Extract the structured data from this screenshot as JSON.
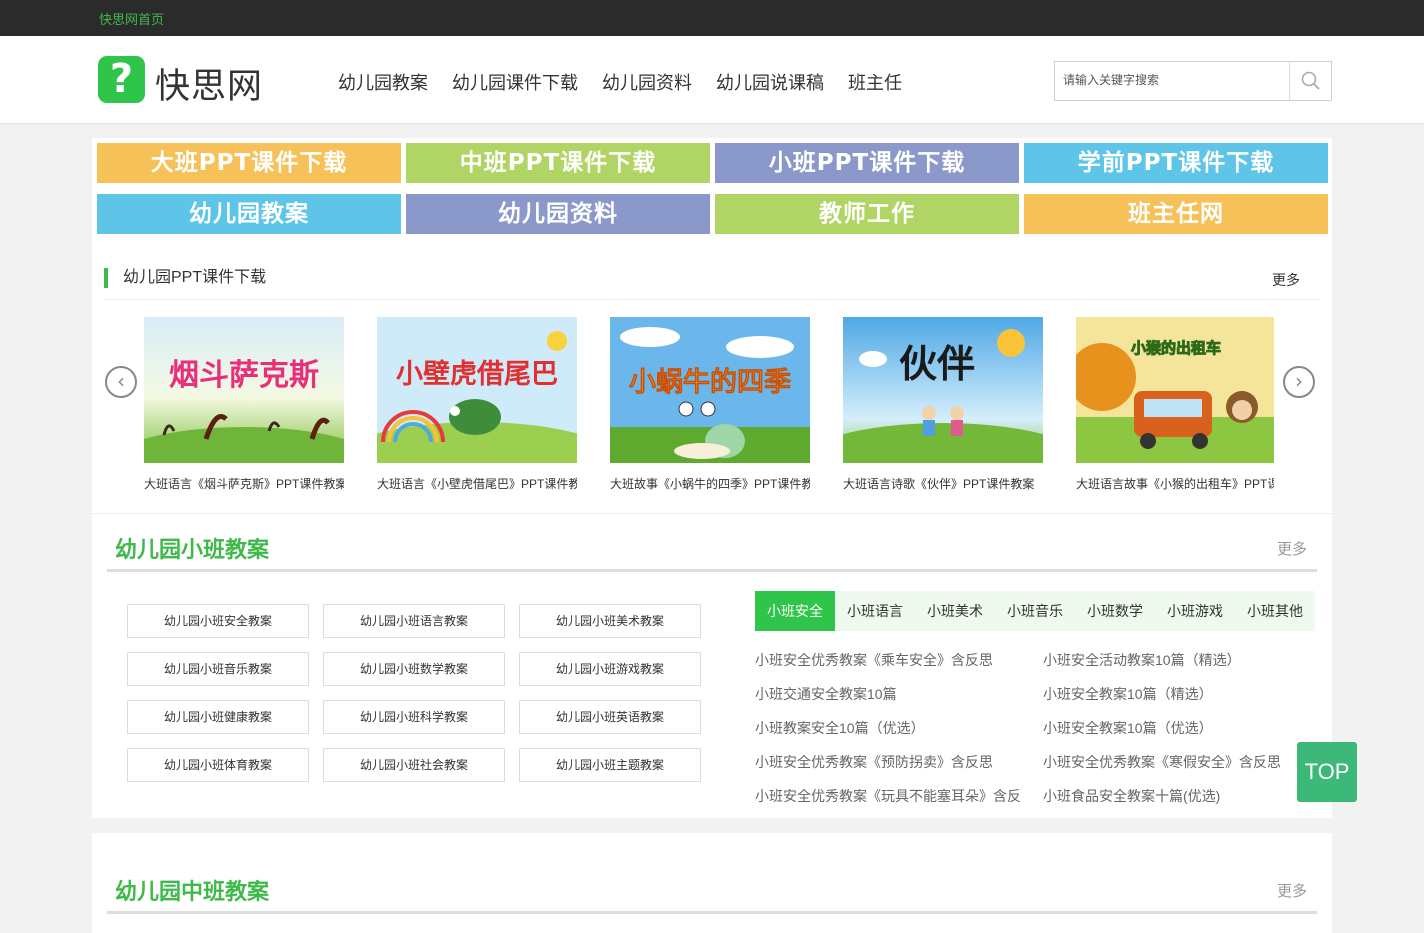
{
  "topbar": {
    "home_link": "快思网首页"
  },
  "header": {
    "logo_text": "快思网",
    "nav": [
      "幼儿园教案",
      "幼儿园课件下载",
      "幼儿园资料",
      "幼儿园说课稿",
      "班主任"
    ],
    "search_placeholder": "请输入关键字搜索"
  },
  "categories": [
    {
      "label": "大班PPT课件下载",
      "color": "#f6c158"
    },
    {
      "label": "中班PPT课件下载",
      "color": "#b0d565"
    },
    {
      "label": "小班PPT课件下载",
      "color": "#8b99ca"
    },
    {
      "label": "学前PPT课件下载",
      "color": "#5ec5e8"
    },
    {
      "label": "幼儿园教案",
      "color": "#5ec5e8"
    },
    {
      "label": "幼儿园资料",
      "color": "#8b99ca"
    },
    {
      "label": "教师工作",
      "color": "#b0d565"
    },
    {
      "label": "班主任网",
      "color": "#f6c158"
    }
  ],
  "ppt_section": {
    "title": "幼儿园PPT课件下载",
    "more": "更多",
    "items": [
      {
        "thumb_text": "烟斗萨克斯",
        "caption": "大班语言《烟斗萨克斯》PPT课件教案"
      },
      {
        "thumb_text": "小壁虎借尾巴",
        "caption": "大班语言《小壁虎借尾巴》PPT课件教案"
      },
      {
        "thumb_text": "小蜗牛的四季",
        "caption": "大班故事《小蜗牛的四季》PPT课件教案"
      },
      {
        "thumb_text": "伙伴",
        "caption": "大班语言诗歌《伙伴》PPT课件教案"
      },
      {
        "thumb_text": "小猴的出租车",
        "caption": "大班语言故事《小猴的出租车》PPT课件"
      }
    ]
  },
  "xiaoban": {
    "title": "幼儿园小班教案",
    "more": "更多",
    "tags": [
      "幼儿园小班安全教案",
      "幼儿园小班语言教案",
      "幼儿园小班美术教案",
      "幼儿园小班音乐教案",
      "幼儿园小班数学教案",
      "幼儿园小班游戏教案",
      "幼儿园小班健康教案",
      "幼儿园小班科学教案",
      "幼儿园小班英语教案",
      "幼儿园小班体育教案",
      "幼儿园小班社会教案",
      "幼儿园小班主题教案"
    ],
    "tabs": [
      "小班安全",
      "小班语言",
      "小班美术",
      "小班音乐",
      "小班数学",
      "小班游戏",
      "小班其他"
    ],
    "links_left": [
      "小班安全优秀教案《乘车安全》含反思",
      "小班交通安全教案10篇",
      "小班教案安全10篇（优选）",
      "小班安全优秀教案《预防拐卖》含反思",
      "小班安全优秀教案《玩具不能塞耳朵》含反"
    ],
    "links_right": [
      "小班安全活动教案10篇（精选）",
      "小班安全教案10篇（精选）",
      "小班安全教案10篇（优选）",
      "小班安全优秀教案《寒假安全》含反思",
      "小班食品安全教案十篇(优选)"
    ]
  },
  "zhongban": {
    "title": "幼儿园中班教案",
    "more": "更多"
  },
  "top_button": "TOP"
}
